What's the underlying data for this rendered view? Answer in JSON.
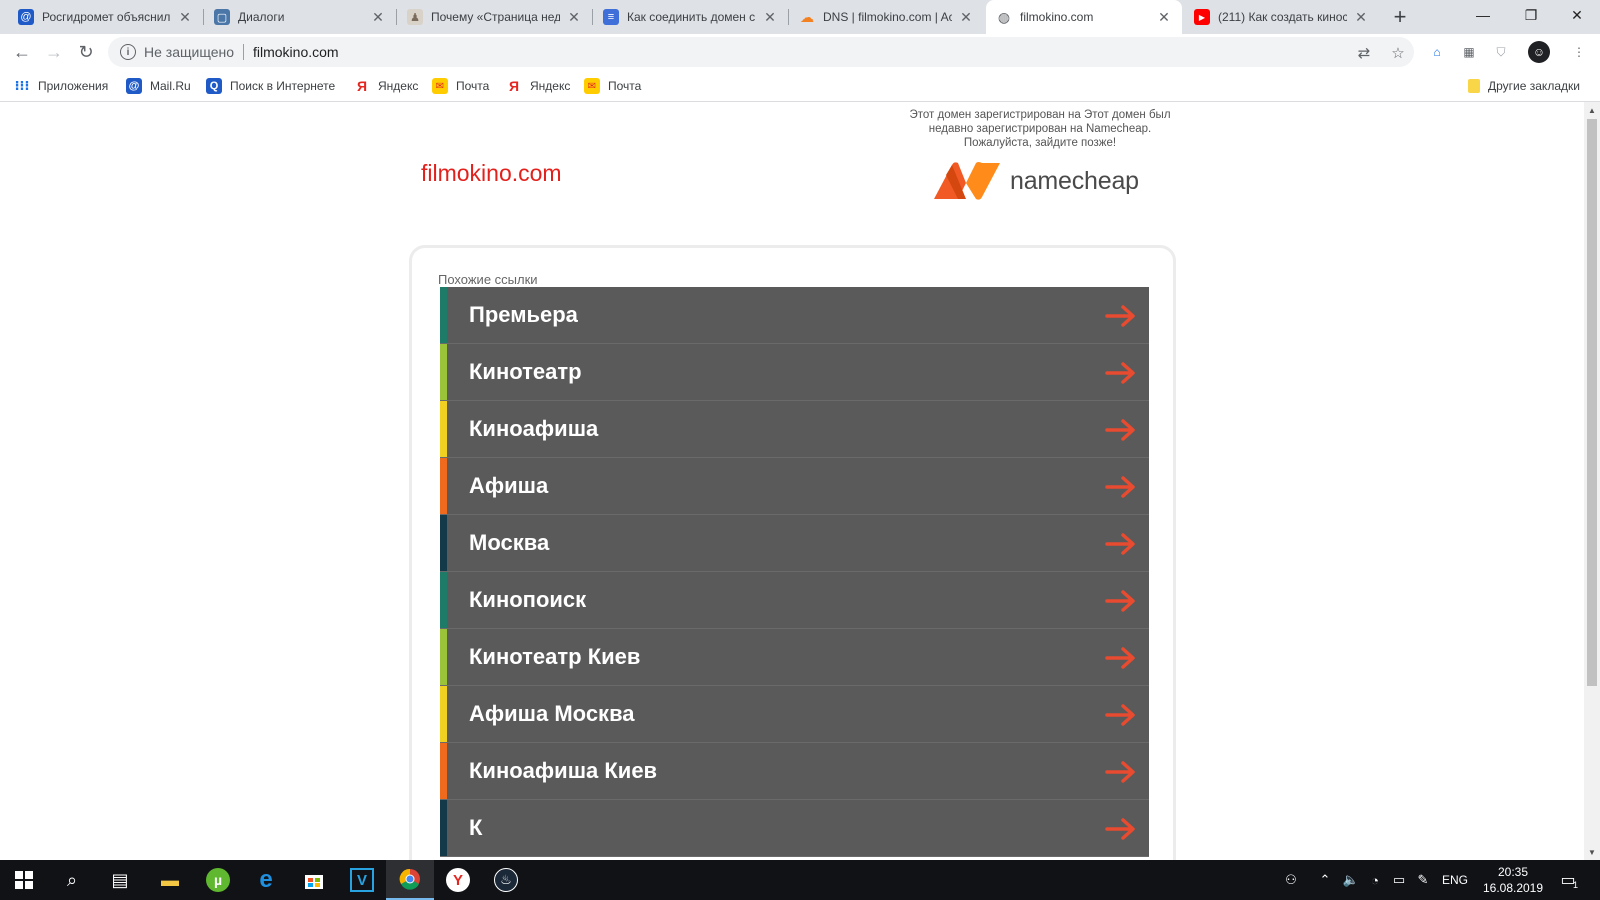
{
  "browser": {
    "tabs": [
      {
        "title": "Росгидромет объяснил",
        "icon": "mailru-icon",
        "icon_color": "#1f5ac7"
      },
      {
        "title": "Диалоги",
        "icon": "vk-chat-icon",
        "icon_color": "#4a76a8"
      },
      {
        "title": "Почему «Страница недо",
        "icon": "person-icon",
        "icon_color": "#7a6a5a"
      },
      {
        "title": "Как соединить домен с",
        "icon": "database-icon",
        "icon_color": "#3f6fd8"
      },
      {
        "title": "DNS | filmokino.com | Ac",
        "icon": "cloudflare-icon",
        "icon_color": "#f48120"
      },
      {
        "title": "filmokino.com",
        "icon": "globe-icon",
        "icon_color": "#5f6368",
        "active": true
      },
      {
        "title": "(211) Как создать кинос",
        "icon": "youtube-icon",
        "icon_color": "#ff0000"
      }
    ],
    "new_tab_label": "+",
    "address": {
      "security_text": "Не защищено",
      "url": "filmokino.com"
    },
    "bookmarks": [
      {
        "label": "Приложения",
        "icon": "apps-grid-icon"
      },
      {
        "label": "Mail.Ru",
        "icon": "mailru-icon"
      },
      {
        "label": "Поиск в Интернете",
        "icon": "search-icon"
      },
      {
        "label": "Яндекс",
        "icon": "yandex-icon"
      },
      {
        "label": "Почта",
        "icon": "mail-envelope-icon"
      },
      {
        "label": "Яндекс",
        "icon": "yandex-icon"
      },
      {
        "label": "Почта",
        "icon": "mail-envelope-icon"
      }
    ],
    "other_bookmarks": "Другие закладки"
  },
  "page": {
    "domain_title": "filmokino.com",
    "namecheap_note": "Этот домен зарегистрирован на Этот домен был недавно зарегистрирован на Namecheap. Пожалуйста, зайдите позже!",
    "namecheap_brand": "namecheap",
    "related_label": "Похожие ссылки",
    "links": [
      {
        "text": "Премьера",
        "color": "#1e7b68"
      },
      {
        "text": "Кинотеатр",
        "color": "#9bc33a"
      },
      {
        "text": "Киноафиша",
        "color": "#f0d020"
      },
      {
        "text": "Афиша",
        "color": "#ef6a1c"
      },
      {
        "text": "Москва",
        "color": "#143a4a"
      },
      {
        "text": "Кинопоиск",
        "color": "#1e7b68"
      },
      {
        "text": "Кинотеатр Киев",
        "color": "#9bc33a"
      },
      {
        "text": "Афиша Москва",
        "color": "#f0d020"
      },
      {
        "text": "Киноафиша Киев",
        "color": "#ef6a1c"
      },
      {
        "text": "К",
        "color": "#143a4a"
      }
    ],
    "arrow_color": "#e84b2f"
  },
  "taskbar": {
    "language": "ENG",
    "time": "20:35",
    "date": "16.08.2019",
    "notification_count": "1"
  }
}
